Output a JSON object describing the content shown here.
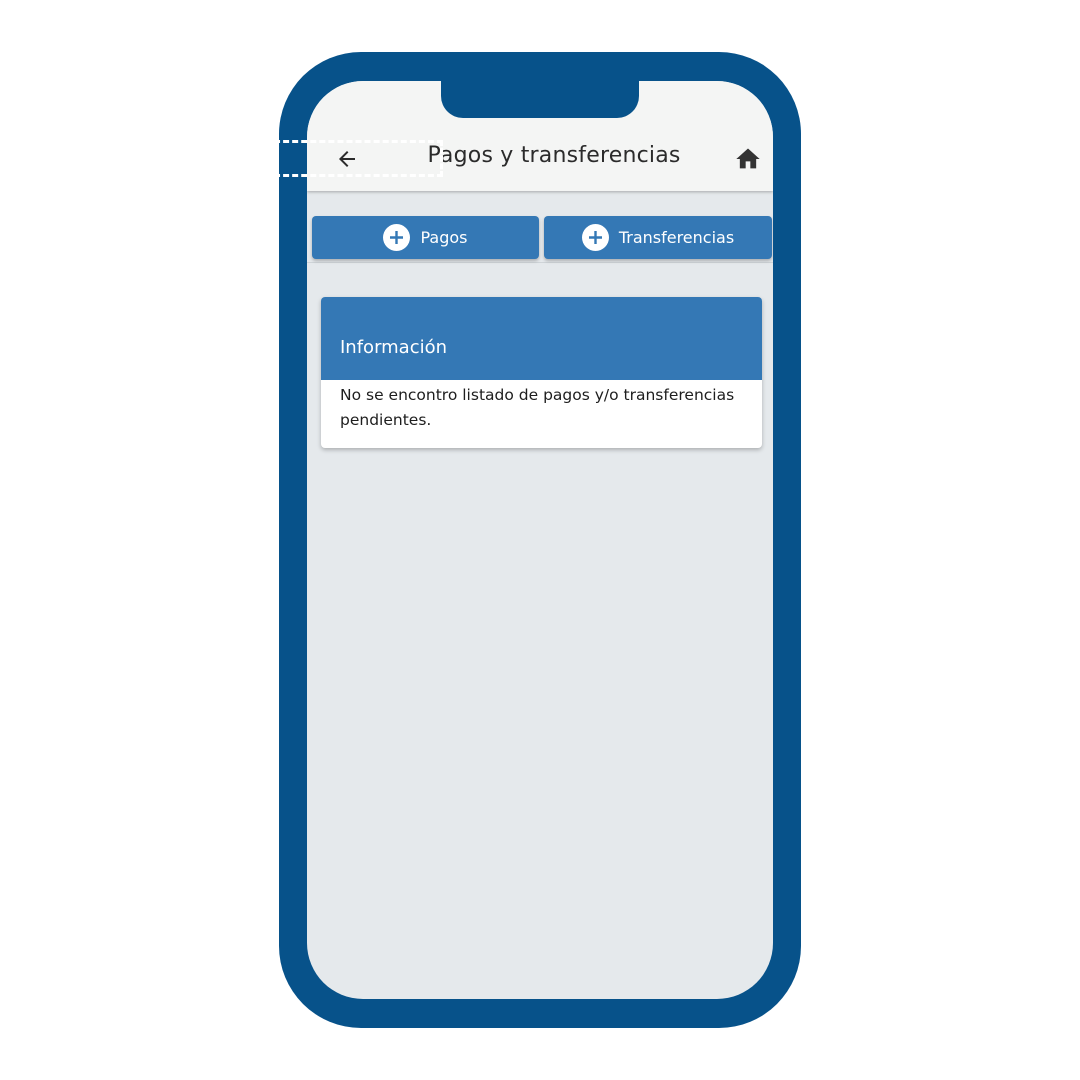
{
  "header": {
    "title": "Pagos y transferencias",
    "back_icon": "arrow-left-icon",
    "home_icon": "home-icon"
  },
  "actions": {
    "pagos_label": "Pagos",
    "transferencias_label": "Transferencias",
    "icon": "plus-circle-icon",
    "highlighted": "Transferencias"
  },
  "info_card": {
    "title": "Información",
    "message": "No se encontro listado de pagos y/o transferencias pendientes."
  },
  "colors": {
    "frame": "#07528a",
    "primary": "#3478b5",
    "background": "#e5e9ec",
    "header_bg": "#f4f5f4"
  }
}
